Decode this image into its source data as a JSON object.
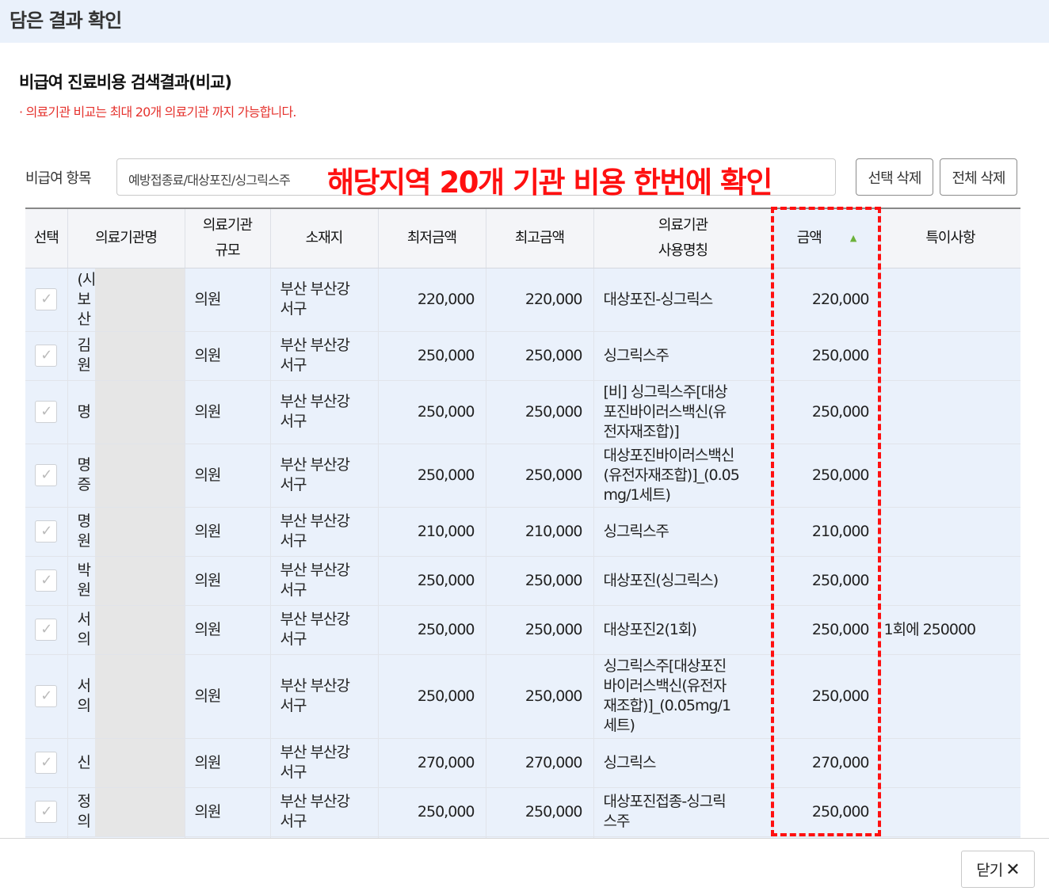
{
  "header": {
    "title": "담은 결과 확인"
  },
  "section": {
    "title": "비급여 진료비용 검색결과(비교)",
    "notice": "· 의료기관 비교는 최대 20개 의료기관 까지 가능합니다."
  },
  "filter": {
    "label": "비급여 항목",
    "value": "예방접종료/대상포진/싱그릭스주",
    "callout": "해당지역 20개 기관 비용 한번에 확인",
    "select_delete_label": "선택 삭제",
    "delete_all_label": "전체 삭제"
  },
  "table": {
    "columns": {
      "select": "선택",
      "institution": "의료기관명",
      "size_1": "의료기관",
      "size_2": "규모",
      "location": "소재지",
      "min": "최저금액",
      "max": "최고금액",
      "name_1": "의료기관",
      "name_2": "사용명칭",
      "amount": "금액",
      "note": "특이사항"
    },
    "rows": [
      {
        "inst": [
          "(시",
          "보",
          "산"
        ],
        "size": "의원",
        "loc": [
          "부산 부산강",
          "서구"
        ],
        "min": "220,000",
        "max": "220,000",
        "name": [
          "대상포진-싱그릭스"
        ],
        "amount": "220,000",
        "note": ""
      },
      {
        "inst": [
          "김",
          "원"
        ],
        "size": "의원",
        "loc": [
          "부산 부산강",
          "서구"
        ],
        "min": "250,000",
        "max": "250,000",
        "name": [
          "싱그릭스주"
        ],
        "amount": "250,000",
        "note": ""
      },
      {
        "inst": [
          "명"
        ],
        "size": "의원",
        "loc": [
          "부산 부산강",
          "서구"
        ],
        "min": "250,000",
        "max": "250,000",
        "name": [
          "[비] 싱그릭스주[대상",
          "포진바이러스백신(유",
          "전자재조합)]"
        ],
        "amount": "250,000",
        "note": ""
      },
      {
        "inst": [
          "명",
          "증"
        ],
        "size": "의원",
        "loc": [
          "부산 부산강",
          "서구"
        ],
        "min": "250,000",
        "max": "250,000",
        "name": [
          "대상포진바이러스백신",
          "(유전자재조합)]_(0.05",
          "mg/1세트)"
        ],
        "amount": "250,000",
        "note": ""
      },
      {
        "inst": [
          "명",
          "원"
        ],
        "size": "의원",
        "loc": [
          "부산 부산강",
          "서구"
        ],
        "min": "210,000",
        "max": "210,000",
        "name": [
          "싱그릭스주"
        ],
        "amount": "210,000",
        "note": ""
      },
      {
        "inst": [
          "박",
          "원"
        ],
        "size": "의원",
        "loc": [
          "부산 부산강",
          "서구"
        ],
        "min": "250,000",
        "max": "250,000",
        "name": [
          "대상포진(싱그릭스)"
        ],
        "amount": "250,000",
        "note": ""
      },
      {
        "inst": [
          "서",
          "의"
        ],
        "size": "의원",
        "loc": [
          "부산 부산강",
          "서구"
        ],
        "min": "250,000",
        "max": "250,000",
        "name": [
          "대상포진2(1회)"
        ],
        "amount": "250,000",
        "note": "1회에 250000"
      },
      {
        "inst": [
          "서",
          "의"
        ],
        "size": "의원",
        "loc": [
          "부산 부산강",
          "서구"
        ],
        "min": "250,000",
        "max": "250,000",
        "name": [
          "싱그릭스주[대상포진",
          "바이러스백신(유전자",
          "재조합)]_(0.05mg/1",
          "세트)"
        ],
        "amount": "250,000",
        "note": ""
      },
      {
        "inst": [
          "신"
        ],
        "size": "의원",
        "loc": [
          "부산 부산강",
          "서구"
        ],
        "min": "270,000",
        "max": "270,000",
        "name": [
          "싱그릭스"
        ],
        "amount": "270,000",
        "note": ""
      },
      {
        "inst": [
          "정",
          "의"
        ],
        "size": "의원",
        "loc": [
          "부산 부산강",
          "서구"
        ],
        "min": "250,000",
        "max": "250,000",
        "name": [
          "대상포진접종-싱그릭",
          "스주"
        ],
        "amount": "250,000",
        "note": ""
      }
    ]
  },
  "footer": {
    "close_label": "닫기",
    "close_icon": "✕"
  }
}
